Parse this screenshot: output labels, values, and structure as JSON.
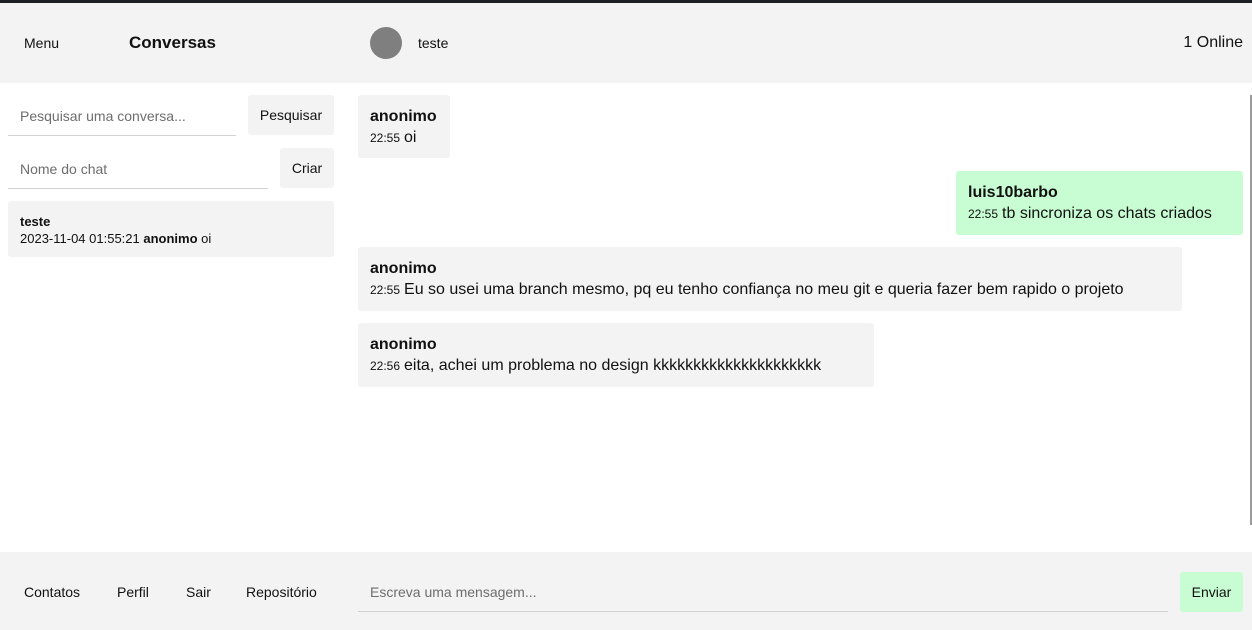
{
  "header": {
    "menu_label": "Menu",
    "conversations_title": "Conversas",
    "chat_name": "teste",
    "online_status": "1 Online"
  },
  "sidebar": {
    "search": {
      "placeholder": "Pesquisar uma conversa...",
      "button_label": "Pesquisar"
    },
    "create": {
      "placeholder": "Nome do chat",
      "button_label": "Criar"
    },
    "conversations": [
      {
        "name": "teste",
        "timestamp": "2023-11-04 01:55:21",
        "last_author": "anonimo",
        "last_message": "oi"
      }
    ]
  },
  "messages": [
    {
      "author": "anonimo",
      "time": "22:55",
      "text": "oi",
      "own": false
    },
    {
      "author": "luis10barbo",
      "time": "22:55",
      "text": "tb sincroniza os chats criados",
      "own": true
    },
    {
      "author": "anonimo",
      "time": "22:55",
      "text": "Eu so usei uma branch mesmo, pq eu tenho confiança no meu git e queria fazer bem rapido o projeto",
      "own": false
    },
    {
      "author": "anonimo",
      "time": "22:56",
      "text": "eita, achei um problema no design kkkkkkkkkkkkkkkkkkkkk",
      "own": false
    }
  ],
  "footer": {
    "nav": [
      "Contatos",
      "Perfil",
      "Sair",
      "Repositório"
    ],
    "message_placeholder": "Escreva uma mensagem...",
    "send_label": "Enviar"
  },
  "colors": {
    "panel_bg": "#f3f3f3",
    "own_message_bg": "#c8fdd3",
    "avatar": "#7f7f7f"
  }
}
